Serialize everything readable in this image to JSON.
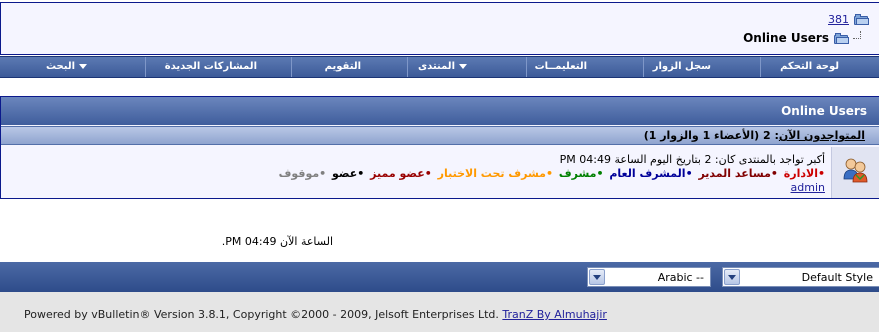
{
  "breadcrumb": {
    "link_text": "381",
    "title": "Online Users"
  },
  "menu": {
    "items": [
      {
        "label": "لوحة التحكم",
        "dropdown": false
      },
      {
        "label": "سجل الزوار",
        "dropdown": false
      },
      {
        "label": "التعليمــات",
        "dropdown": false
      },
      {
        "label": "المنتدى",
        "dropdown": true
      },
      {
        "label": "التقويم",
        "dropdown": false
      },
      {
        "label": "المشاركات الجديدة",
        "dropdown": false
      },
      {
        "label": "البحث",
        "dropdown": true
      }
    ]
  },
  "online_users": {
    "header": "Online Users",
    "subheader_link": "المتواجدون الآن",
    "subheader_rest": ": 2 (الأعضاء 1 والزوار 1)",
    "record_line": "أكبر تواجد بالمنتدى كان: 2 بتاريخ اليوم الساعة 04:49 PM",
    "legend": [
      {
        "label": "الادارة",
        "color": "#cc0000"
      },
      {
        "label": "مساعد المدير",
        "color": "#800000"
      },
      {
        "label": "المشرف العام",
        "color": "#000099"
      },
      {
        "label": "مشرف",
        "color": "#008000"
      },
      {
        "label": "مشرف تحت الاختبار",
        "color": "#ff9900"
      },
      {
        "label": "عضو مميز",
        "color": "#990000"
      },
      {
        "label": "عضو",
        "color": "#000000"
      },
      {
        "label": "موقوف",
        "color": "#808080"
      }
    ],
    "bullet": "•",
    "users": [
      "admin"
    ]
  },
  "current_time": "الساعة الآن 04:49 PM.",
  "footer": {
    "style_select": "Default Style",
    "language_select": "Arabic --",
    "copyright": "Powered by vBulletin® Version 3.8.1, Copyright ©2000 - 2009, Jelsoft Enterprises Ltd.",
    "tranz_link": "TranZ By Almuhajir"
  },
  "colors": {
    "nav_bar": "#3c5a98",
    "panel_bg": "#f5f5ff",
    "link": "#22229c"
  }
}
